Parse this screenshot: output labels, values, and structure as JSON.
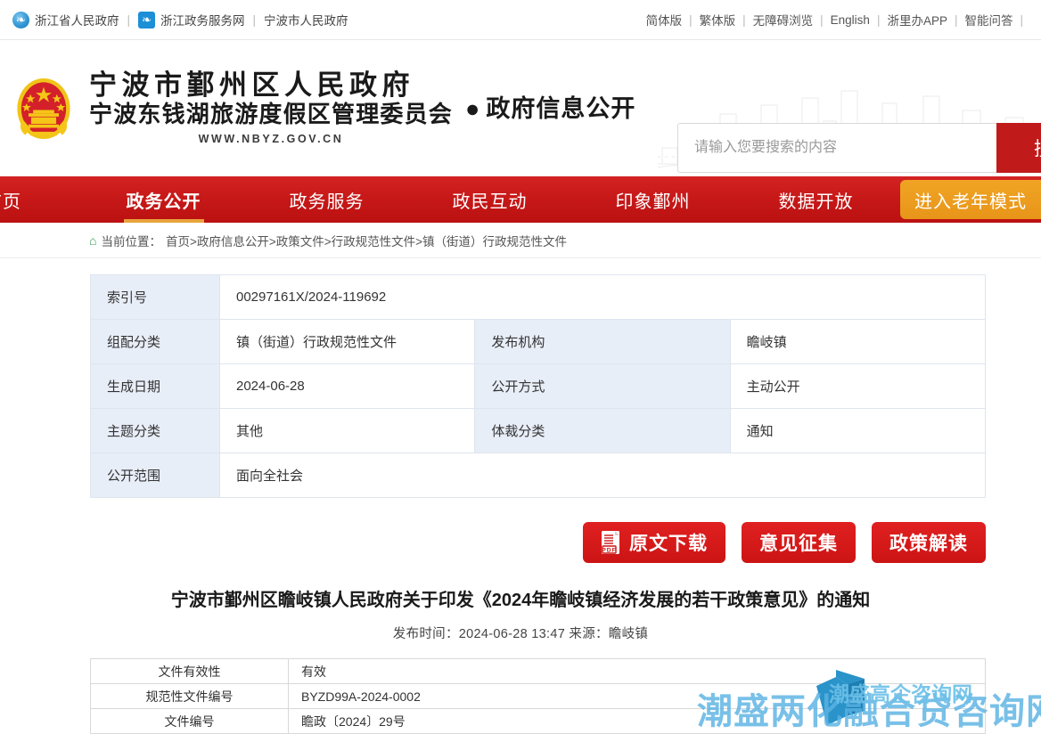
{
  "topbar": {
    "left_links": [
      {
        "label": "浙江省人民政府",
        "icon": "zhejiang-gov-circle-icon",
        "style": "circle"
      },
      {
        "label": "浙江政务服务网",
        "icon": "zhejiang-service-square-icon",
        "style": "square"
      },
      {
        "label": "宁波市人民政府",
        "icon": "",
        "style": "none"
      }
    ],
    "separator": "|",
    "right_links": [
      "简体版",
      "繁体版",
      "无障碍浏览",
      "English",
      "浙里办APP",
      "智能问答"
    ]
  },
  "header": {
    "title_line1": "宁波市鄞州区人民政府",
    "title_line2": "宁波东钱湖旅游度假区管理委员会",
    "url": "WWW.NBYZ.GOV.CN",
    "dot": "●",
    "subtitle": "政府信息公开",
    "emblem_name": "national-emblem-icon",
    "skyline_name": "city-skyline-watermark"
  },
  "search": {
    "placeholder": "请输入您要搜索的内容",
    "value": "",
    "button_label": "搜索"
  },
  "nav": {
    "items": [
      {
        "label": "首页",
        "active": false
      },
      {
        "label": "政务公开",
        "active": true
      },
      {
        "label": "政务服务",
        "active": false
      },
      {
        "label": "政民互动",
        "active": false
      },
      {
        "label": "印象鄞州",
        "active": false
      },
      {
        "label": "数据开放",
        "active": false
      }
    ],
    "elder_mode_label": "进入老年模式",
    "bg_color": "#c51717",
    "accent_color": "#e8a33d"
  },
  "breadcrumb": {
    "home_icon": "home-icon",
    "prefix": "当前位置：",
    "path": "首页>政府信息公开>政策文件>行政规范性文件>镇（街道）行政规范性文件"
  },
  "meta_table": {
    "rows": [
      {
        "label1": "索引号",
        "value1": "00297161X/2024-119692",
        "label2": "",
        "value2": "",
        "span": true
      },
      {
        "label1": "组配分类",
        "value1": "镇（街道）行政规范性文件",
        "label2": "发布机构",
        "value2": "瞻岐镇",
        "span": false
      },
      {
        "label1": "生成日期",
        "value1": "2024-06-28",
        "label2": "公开方式",
        "value2": "主动公开",
        "span": false
      },
      {
        "label1": "主题分类",
        "value1": "其他",
        "label2": "体裁分类",
        "value2": "通知",
        "span": false
      },
      {
        "label1": "公开范围",
        "value1": "面向全社会",
        "label2": "",
        "value2": "",
        "span": true
      }
    ]
  },
  "actions": {
    "download_label": "原文下载",
    "download_icon": "pdf-file-icon",
    "feedback_label": "意见征集",
    "interpretation_label": "政策解读",
    "button_color": "#cc1414"
  },
  "document": {
    "title": "宁波市鄞州区瞻岐镇人民政府关于印发《2024年瞻岐镇经济发展的若干政策意见》的通知",
    "publish_info": "发布时间：2024-06-28 13:47 来源：瞻岐镇"
  },
  "file_table": {
    "rows": [
      {
        "label": "文件有效性",
        "value": "有效"
      },
      {
        "label": "规范性文件编号",
        "value": "BYZD99A-2024-0002"
      },
      {
        "label": "文件编号",
        "value": "瞻政〔2024〕29号"
      }
    ]
  },
  "watermark": {
    "big_text": "潮盛两化融合贷咨询网",
    "small_text": "潮盛高企咨询网",
    "color": "#5bb3e4"
  }
}
